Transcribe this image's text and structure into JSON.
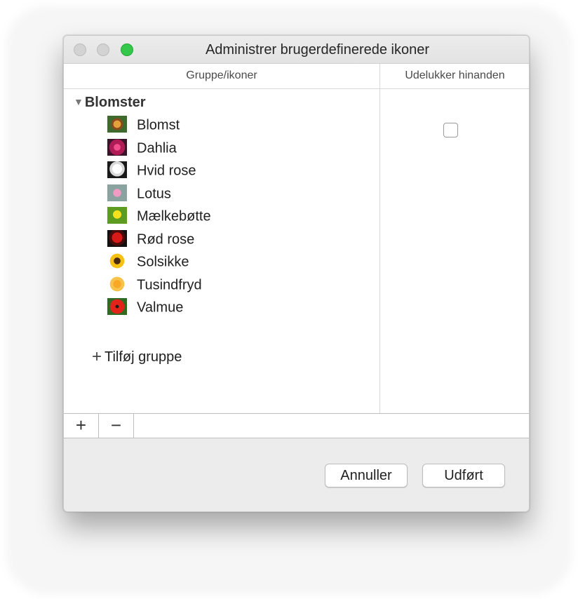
{
  "window": {
    "title": "Administrer brugerdefinerede ikoner"
  },
  "table": {
    "columns": [
      "Gruppe/ikoner",
      "Udelukker hinanden"
    ],
    "group": {
      "disclosure": "▼",
      "name": "Blomster",
      "exclusive_checked": false,
      "items": [
        {
          "label": "Blomst",
          "icon": "flower-icon"
        },
        {
          "label": "Dahlia",
          "icon": "dahlia-icon"
        },
        {
          "label": "Hvid rose",
          "icon": "white-rose-icon"
        },
        {
          "label": "Lotus",
          "icon": "lotus-icon"
        },
        {
          "label": "Mælkebøtte",
          "icon": "dandelion-icon"
        },
        {
          "label": "Rød rose",
          "icon": "red-rose-icon"
        },
        {
          "label": "Solsikke",
          "icon": "sunflower-icon"
        },
        {
          "label": "Tusindfryd",
          "icon": "daisy-icon"
        },
        {
          "label": "Valmue",
          "icon": "poppy-icon"
        }
      ]
    },
    "add_group": {
      "glyph": "+",
      "label": "Tilføj gruppe"
    }
  },
  "footer": {
    "add_symbol": "+",
    "remove_symbol": "−"
  },
  "buttons": {
    "cancel": "Annuller",
    "done": "Udført"
  }
}
